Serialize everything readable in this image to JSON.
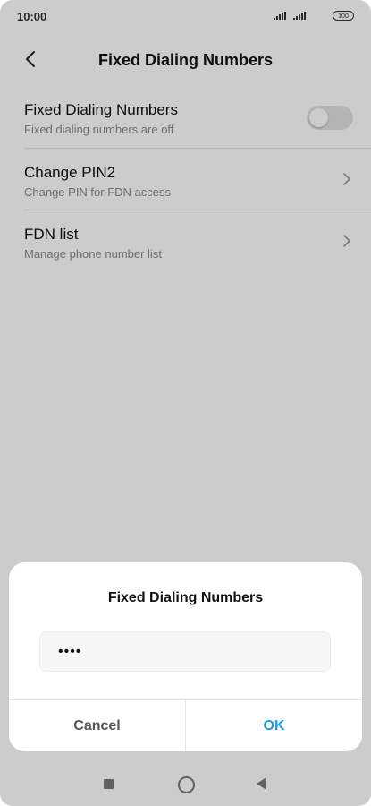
{
  "status_bar": {
    "time": "10:00",
    "battery": "100"
  },
  "header": {
    "title": "Fixed Dialing Numbers"
  },
  "settings": [
    {
      "label": "Fixed Dialing Numbers",
      "subtitle": "Fixed dialing numbers are off",
      "control": "toggle",
      "on": false
    },
    {
      "label": "Change PIN2",
      "subtitle": "Change PIN for FDN access",
      "control": "chevron"
    },
    {
      "label": "FDN list",
      "subtitle": "Manage phone number list",
      "control": "chevron"
    }
  ],
  "dialog": {
    "title": "Fixed Dialing Numbers",
    "pin_value": "••••",
    "cancel_label": "Cancel",
    "ok_label": "OK"
  },
  "colors": {
    "accent": "#1a9ae0",
    "toggle_off": "#e2e2e2"
  },
  "icons": {
    "back": "back-arrow-icon",
    "chevron": "chevron-right-icon",
    "nav_recents": "square-icon",
    "nav_home": "circle-icon",
    "nav_back": "triangle-back-icon"
  }
}
